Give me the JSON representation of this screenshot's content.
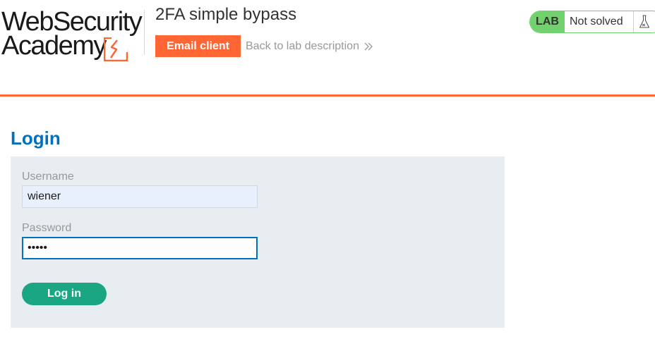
{
  "brand": {
    "line1": "WebSecurity",
    "line2": "Academy",
    "accent_color": "#ff6633"
  },
  "lab": {
    "title": "2FA simple bypass",
    "email_client_label": "Email client",
    "back_link_label": "Back to lab description",
    "back_link_icon": "double-chevron-right-icon",
    "badge_label": "LAB",
    "status_label": "Not solved",
    "status_icon": "flask-icon",
    "status_color": "#70d16d"
  },
  "page": {
    "title": "Login"
  },
  "login_form": {
    "username_label": "Username",
    "username_value": "wiener",
    "password_label": "Password",
    "password_value": "•••••",
    "submit_label": "Log in",
    "submit_color": "#1aa683",
    "focus_color": "#0071bc"
  }
}
